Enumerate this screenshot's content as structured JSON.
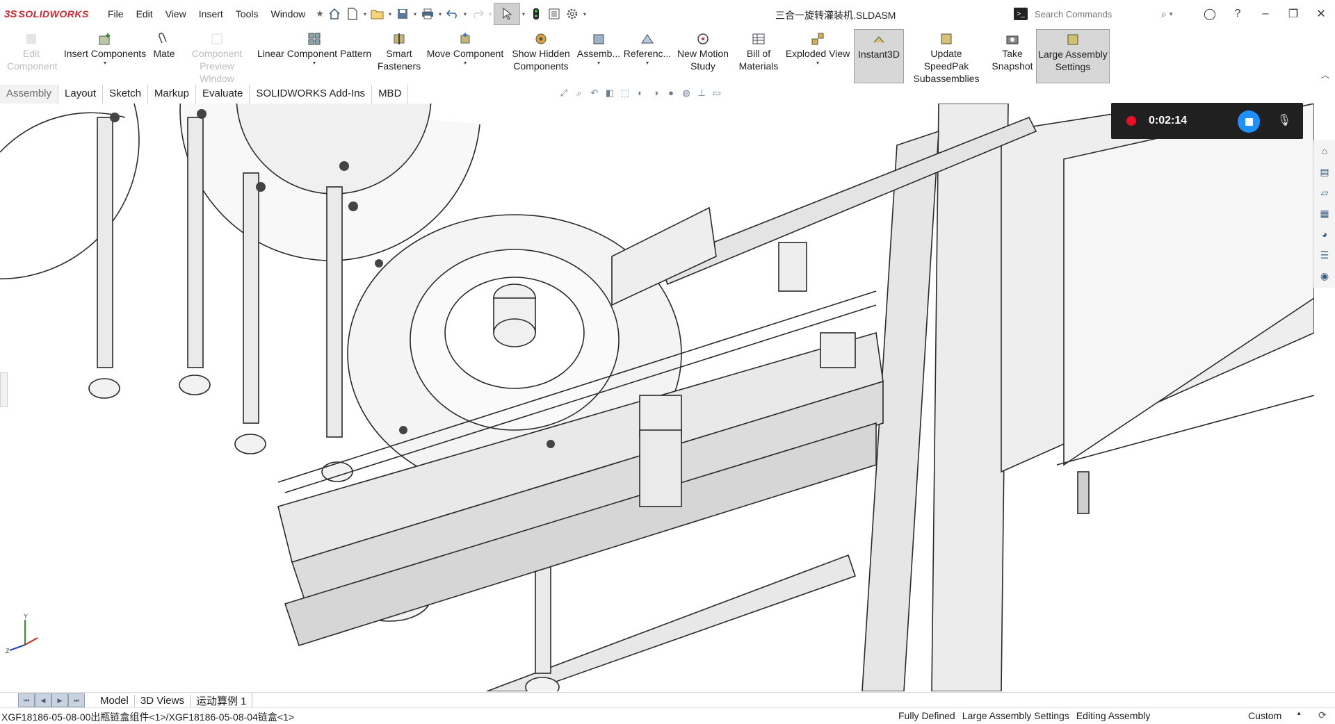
{
  "app": {
    "brand": "SOLIDWORKS",
    "document_title": "三合一旋转灌装机.SLDASM"
  },
  "menu": [
    "File",
    "Edit",
    "View",
    "Insert",
    "Tools",
    "Window"
  ],
  "search": {
    "placeholder": "Search Commands"
  },
  "ribbon": {
    "edit_component": "Edit Component",
    "insert_components": "Insert Components",
    "mate": "Mate",
    "component_preview_window": "Component Preview Window",
    "linear_component_pattern": "Linear Component Pattern",
    "smart_fasteners": "Smart Fasteners",
    "move_component": "Move Component",
    "show_hidden_components": "Show Hidden Components",
    "assembly": "Assemb...",
    "reference": "Referenc...",
    "new_motion_study": "New Motion Study",
    "bill_of_materials": "Bill of Materials",
    "exploded_view": "Exploded View",
    "instant3d": "Instant3D",
    "update_speedpak": "Update SpeedPak Subassemblies",
    "take_snapshot": "Take Snapshot",
    "large_assembly_settings": "Large Assembly Settings"
  },
  "tabs": [
    "Assembly",
    "Layout",
    "Sketch",
    "Markup",
    "Evaluate",
    "SOLIDWORKS Add-Ins",
    "MBD"
  ],
  "recorder": {
    "time": "0:02:14"
  },
  "bottom_tabs": [
    "Model",
    "3D Views",
    "运动算例 1"
  ],
  "status": {
    "path": "XGF18186-05-08-00出瓶链盒组件<1>/XGF18186-05-08-04链盒<1>",
    "definition": "Fully Defined",
    "large_assembly": "Large Assembly Settings",
    "mode": "Editing Assembly",
    "units": "Custom"
  },
  "triad": {
    "y": "Y",
    "z": "Z"
  },
  "colors": {
    "brand": "#d5222f",
    "record": "#e81123",
    "stop": "#1f90ff"
  },
  "icons": [
    "home-icon",
    "new-document-icon",
    "open-icon",
    "save-icon",
    "print-icon",
    "undo-icon",
    "redo-icon",
    "select-arrow-icon",
    "traffic-light-icon",
    "file-properties-icon",
    "options-gear-icon",
    "search-icon",
    "account-icon",
    "help-icon"
  ]
}
